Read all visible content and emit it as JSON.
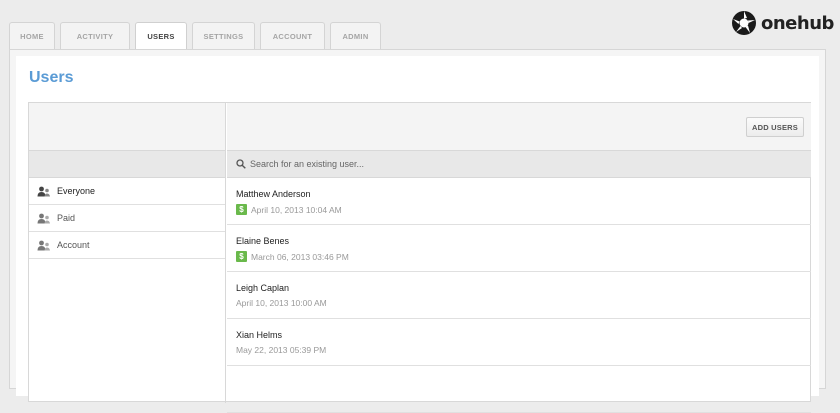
{
  "nav": {
    "tabs": [
      {
        "label": "HOME"
      },
      {
        "label": "ACTIVITY"
      },
      {
        "label": "USERS",
        "active": true
      },
      {
        "label": "SETTINGS"
      },
      {
        "label": "ACCOUNT"
      },
      {
        "label": "ADMIN"
      }
    ]
  },
  "logo": {
    "text": "onehub"
  },
  "page": {
    "title": "Users"
  },
  "toolbar": {
    "add_users_label": "ADD USERS"
  },
  "search": {
    "placeholder": "Search for an existing user..."
  },
  "groups": [
    {
      "label": "Everyone",
      "icon": "users-icon",
      "active": true
    },
    {
      "label": "Paid",
      "icon": "users-icon"
    },
    {
      "label": "Account",
      "icon": "users-icon"
    }
  ],
  "users": [
    {
      "name": "Matthew Anderson",
      "date": "April 10, 2013 10:04 AM",
      "paid": true
    },
    {
      "name": "Elaine Benes",
      "date": "March 06, 2013 03:46 PM",
      "paid": true
    },
    {
      "name": "Leigh Caplan",
      "date": "April 10, 2013 10:00 AM",
      "paid": false
    },
    {
      "name": "Xian Helms",
      "date": "May 22, 2013 05:39 PM",
      "paid": false
    }
  ],
  "badge": {
    "paid_symbol": "$"
  },
  "colors": {
    "title": "#5a9bd5",
    "paid_badge": "#6ab94b"
  }
}
